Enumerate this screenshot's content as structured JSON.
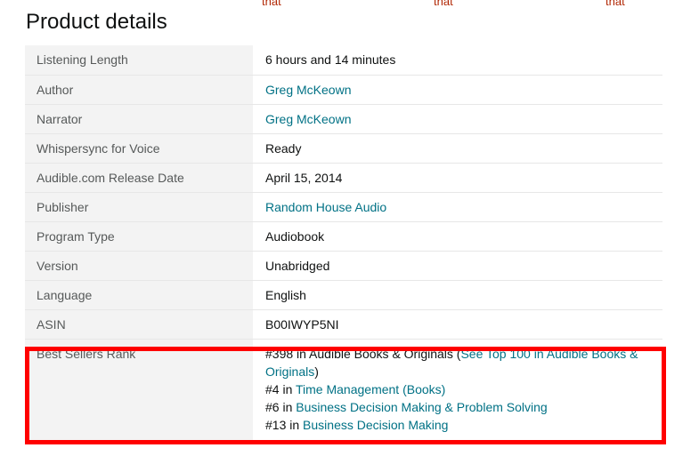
{
  "top_cutoff": {
    "fragments": [
      "that",
      "that",
      "that"
    ]
  },
  "page_title": "Product details",
  "details": [
    {
      "label": "Listening Length",
      "value": "6 hours and 14 minutes",
      "link": false
    },
    {
      "label": "Author",
      "value": "Greg McKeown",
      "link": true
    },
    {
      "label": "Narrator",
      "value": "Greg McKeown",
      "link": true
    },
    {
      "label": "Whispersync for Voice",
      "value": "Ready",
      "link": false
    },
    {
      "label": "Audible.com Release Date",
      "value": "April 15, 2014",
      "link": false
    },
    {
      "label": "Publisher",
      "value": "Random House Audio",
      "link": true
    },
    {
      "label": "Program Type",
      "value": "Audiobook",
      "link": false
    },
    {
      "label": "Version",
      "value": "Unabridged",
      "link": false
    },
    {
      "label": "Language",
      "value": "English",
      "link": false
    },
    {
      "label": "ASIN",
      "value": "B00IWYP5NI",
      "link": false
    }
  ],
  "best_sellers": {
    "label": "Best Sellers Rank",
    "ranks": [
      {
        "prefix": "#398 in Audible Books & Originals (",
        "link": "See Top 100 in Audible Books & Originals",
        "suffix": ")"
      },
      {
        "prefix": "#4 in ",
        "link": "Time Management (Books)",
        "suffix": ""
      },
      {
        "prefix": "#6 in ",
        "link": "Business Decision Making & Problem Solving",
        "suffix": ""
      },
      {
        "prefix": "#13 in ",
        "link": "Business Decision Making",
        "suffix": ""
      }
    ]
  },
  "colors": {
    "link": "#007185",
    "label_bg": "#f3f3f3",
    "highlight": "#ff0000"
  }
}
